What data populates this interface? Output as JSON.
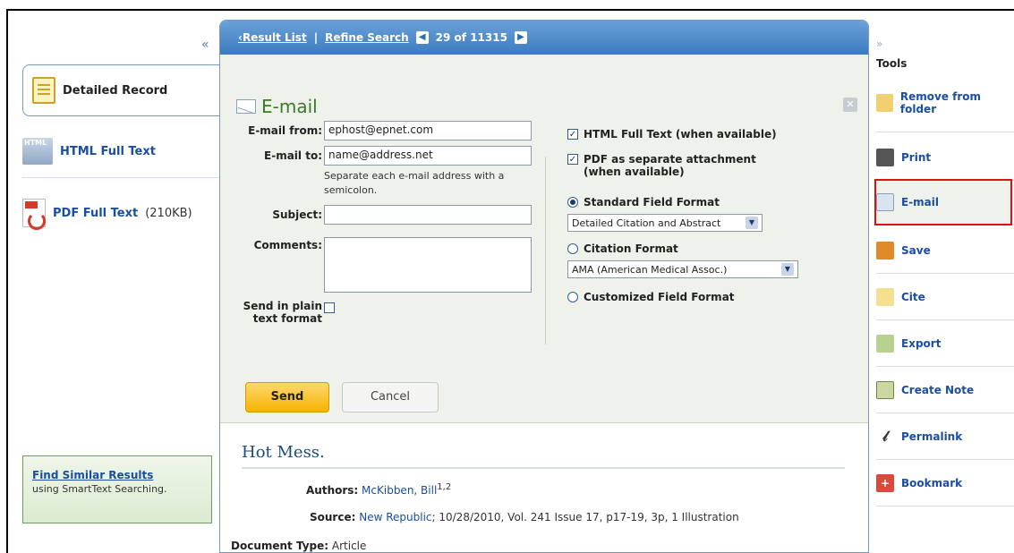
{
  "left_nav": {
    "collapse": "«",
    "items": [
      {
        "label": "Detailed Record"
      },
      {
        "label": "HTML Full Text"
      },
      {
        "label": "PDF Full Text",
        "size": "(210KB)"
      }
    ],
    "find_similar": {
      "title": "Find Similar Results",
      "subtitle": "using SmartText Searching."
    }
  },
  "topbar": {
    "result_list": "‹Result List",
    "refine_search": "Refine Search",
    "position": "29 of 11315"
  },
  "email": {
    "title": "E-mail",
    "from_label": "E-mail from:",
    "from_value": "ephost@epnet.com",
    "to_label": "E-mail to:",
    "to_value": "name@address.net",
    "to_hint_1": "Separate each e-mail address with a",
    "to_hint_2": "semicolon.",
    "subject_label": "Subject:",
    "comments_label": "Comments:",
    "plain_text_label_1": "Send in plain",
    "plain_text_label_2": "text format",
    "options": {
      "html_full_text": "HTML Full Text (when available)",
      "pdf_attachment_1": "PDF as separate attachment",
      "pdf_attachment_2": "(when available)",
      "standard_format": "Standard Field Format",
      "standard_select": "Detailed Citation and Abstract",
      "citation_format": "Citation Format",
      "citation_select": "AMA (American Medical Assoc.)",
      "customized_format": "Customized Field Format"
    },
    "send_label": "Send",
    "cancel_label": "Cancel"
  },
  "record": {
    "title": "Hot Mess.",
    "authors_label": "Authors:",
    "authors_value": "McKibben, Bill",
    "authors_sup": "1,2",
    "source_label": "Source:",
    "source_link": "New Republic",
    "source_rest": "; 10/28/2010, Vol. 241 Issue 17, p17-19, 3p, 1 Illustration",
    "doctype_label": "Document Type:",
    "doctype_value": "Article"
  },
  "tools": {
    "collapse": "»",
    "title": "Tools",
    "items": [
      {
        "label": "Remove from folder"
      },
      {
        "label": "Print"
      },
      {
        "label": "E-mail"
      },
      {
        "label": "Save"
      },
      {
        "label": "Cite"
      },
      {
        "label": "Export"
      },
      {
        "label": "Create Note"
      },
      {
        "label": "Permalink"
      },
      {
        "label": "Bookmark"
      }
    ]
  }
}
